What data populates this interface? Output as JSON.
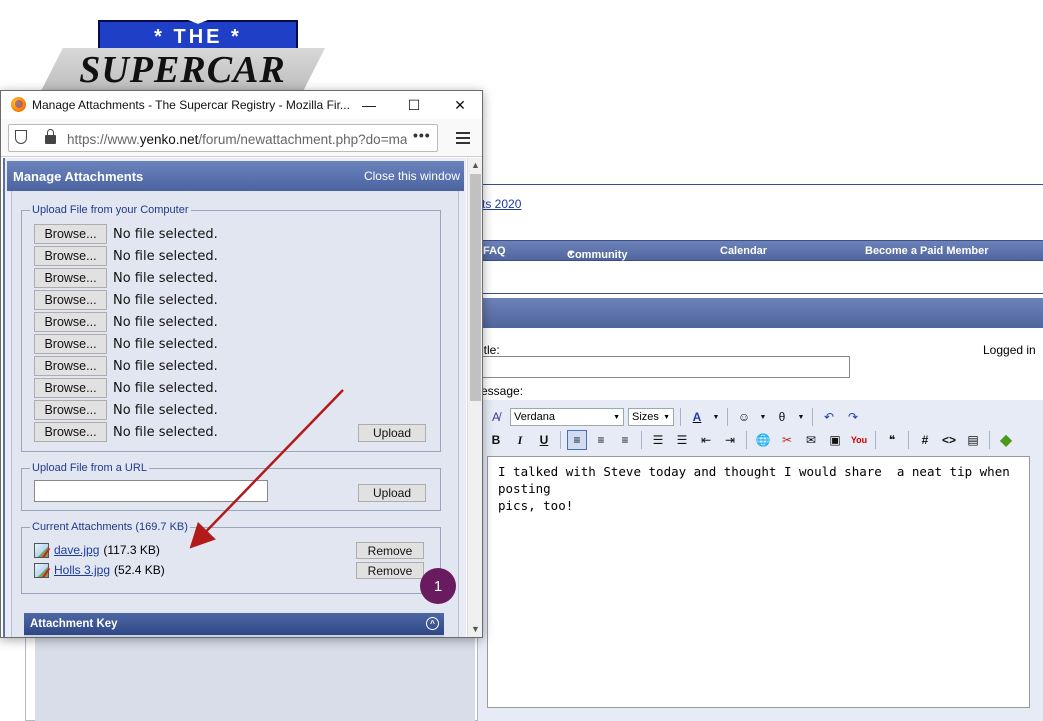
{
  "logo": {
    "banner": "* THE *",
    "text": "SUPERCAR"
  },
  "background": {
    "link_text": "ts 2020",
    "nav": [
      "FAQ",
      "Community",
      "Calendar",
      "Become a Paid Member"
    ],
    "title_label": "itle:",
    "logged_in_label": "Logged in",
    "message_label": "essage:",
    "font_select": "Verdana",
    "size_select": "Sizes",
    "message_text": "I talked with Steve today and thought I would share  a neat tip when posting\npics, too!"
  },
  "popup": {
    "window_title": "Manage Attachments - The Supercar Registry - Mozilla Fir...",
    "url_prefix": "https://www.",
    "url_domain": "yenko.net",
    "url_path": "/forum/newattachment.php?do=manageattach&p=",
    "url_more": "•••",
    "panel_title": "Manage Attachments",
    "close_link": "Close this window",
    "upload_computer_legend": "Upload File from your Computer",
    "browse_label": "Browse...",
    "file_rows": [
      "No file selected.",
      "No file selected.",
      "No file selected.",
      "No file selected.",
      "No file selected.",
      "No file selected.",
      "No file selected.",
      "No file selected.",
      "No file selected.",
      "No file selected."
    ],
    "upload_label": "Upload",
    "upload_url_legend": "Upload File from a URL",
    "url_input_value": "",
    "current_attachments_legend": "Current Attachments (169.7 KB)",
    "attachments": [
      {
        "name": "dave.jpg",
        "size": "(117.3 KB)"
      },
      {
        "name": "Holls 3.jpg",
        "size": "(52.4 KB)"
      }
    ],
    "remove_label": "Remove",
    "attachment_key_title": "Attachment Key"
  },
  "annotation": {
    "step": "1",
    "arrow_color": "#b31b1b"
  },
  "colors": {
    "header_blue": "#4b63a0",
    "panel_bg": "#e2e6f0",
    "link": "#1d3ca0",
    "badge": "#6a1a5e"
  }
}
